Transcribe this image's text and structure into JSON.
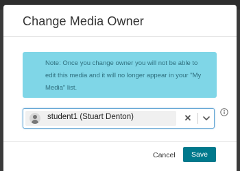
{
  "modal": {
    "title": "Change Media Owner"
  },
  "note": {
    "text": "Note: Once you change owner you will not be able to edit this media and it will no longer appear in your \"My Media\" list."
  },
  "owner_select": {
    "selected_label": "student1 (Stuart Denton)",
    "clear_glyph": "✕",
    "avatar_icon": "user-avatar-icon",
    "dropdown_icon": "chevron-down-icon"
  },
  "info": {
    "icon": "info-icon"
  },
  "footer": {
    "cancel_label": "Cancel",
    "save_label": "Save"
  },
  "colors": {
    "note_background": "#7fd6e7",
    "note_text": "#2f6f7e",
    "primary_button": "#00798c",
    "select_border": "#5fa3d3"
  }
}
